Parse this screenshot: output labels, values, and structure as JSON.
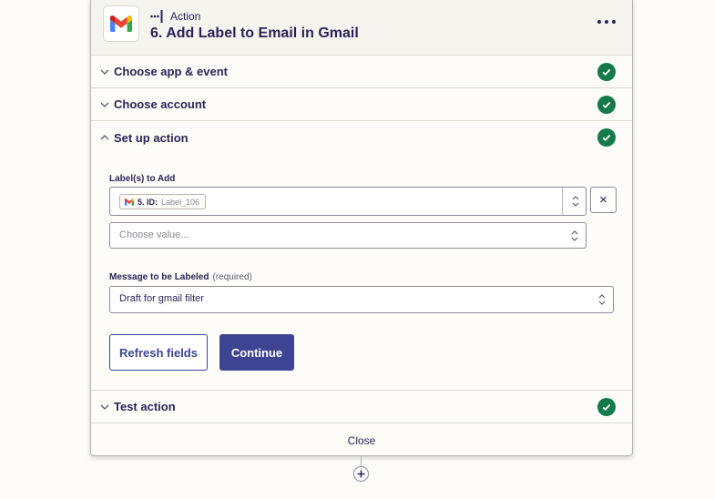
{
  "step": {
    "kind": "Action",
    "title": "6. Add Label to Email in Gmail",
    "app_icon": "gmail-icon",
    "menu_icon": "more-horizontal-icon"
  },
  "sections": {
    "app_event": {
      "label": "Choose app & event",
      "complete": true
    },
    "account": {
      "label": "Choose account",
      "complete": true
    },
    "setup": {
      "label": "Set up action",
      "complete": true,
      "expanded": true
    },
    "test": {
      "label": "Test action",
      "complete": true
    }
  },
  "form": {
    "labels_field": {
      "label": "Label(s) to Add",
      "token": {
        "step": "5. ID:",
        "value": "Label_106",
        "icon": "gmail-icon"
      },
      "remove_label": "×",
      "empty_placeholder": "Choose value..."
    },
    "message_field": {
      "label": "Message to be Labeled",
      "required_text": "(required)",
      "value": "Draft for gmail filter"
    }
  },
  "buttons": {
    "refresh": "Refresh fields",
    "continue": "Continue"
  },
  "footer": {
    "close": "Close"
  },
  "colors": {
    "success": "#147a4b",
    "primary": "#3d4592",
    "text": "#2b2358",
    "background": "#fdfcf8"
  }
}
